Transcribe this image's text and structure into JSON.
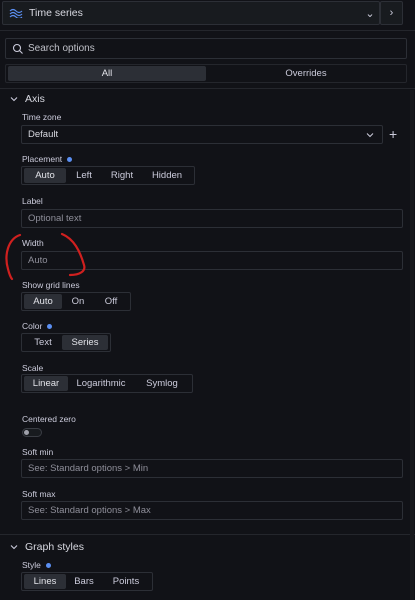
{
  "viz_picker": {
    "name": "Time series",
    "chevron": "⌄",
    "arrow": "›",
    "icon": "time-series-icon"
  },
  "search": {
    "placeholder": "Search options",
    "value": ""
  },
  "tabs": [
    {
      "label": "All",
      "active": true
    },
    {
      "label": "Overrides",
      "active": false
    }
  ],
  "axis": {
    "title": "Axis",
    "time_zone": {
      "label": "Time zone",
      "value": "Default",
      "add": "+"
    },
    "placement": {
      "label": "Placement",
      "options": [
        "Auto",
        "Left",
        "Right",
        "Hidden"
      ],
      "selected": "Auto"
    },
    "label": {
      "label": "Label",
      "placeholder": "Optional text"
    },
    "width": {
      "label": "Width",
      "placeholder": "Auto"
    },
    "grid_lines": {
      "label": "Show grid lines",
      "options": [
        "Auto",
        "On",
        "Off"
      ],
      "selected": "Auto"
    },
    "color": {
      "label": "Color",
      "options": [
        "Text",
        "Series"
      ],
      "selected": "Series"
    },
    "scale": {
      "label": "Scale",
      "options": [
        "Linear",
        "Logarithmic",
        "Symlog"
      ],
      "selected": "Linear"
    },
    "centered_zero": {
      "label": "Centered zero",
      "on": false
    },
    "soft_min": {
      "label": "Soft min",
      "placeholder": "See: Standard options > Min"
    },
    "soft_max": {
      "label": "Soft max",
      "placeholder": "See: Standard options > Max"
    }
  },
  "graph_styles": {
    "title": "Graph styles",
    "style": {
      "label": "Style",
      "options": [
        "Lines",
        "Bars",
        "Points"
      ],
      "selected": "Lines"
    }
  },
  "colors": {
    "accent": "#5b8ff2",
    "annotation": "#d0201f",
    "background": "#111217"
  }
}
